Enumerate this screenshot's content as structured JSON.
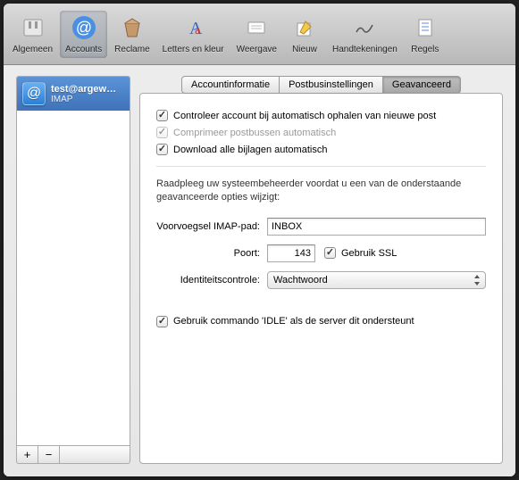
{
  "toolbar": {
    "items": [
      {
        "label": "Algemeen",
        "icon": "switch-icon"
      },
      {
        "label": "Accounts",
        "icon": "at-icon",
        "selected": true
      },
      {
        "label": "Reclame",
        "icon": "junk-icon"
      },
      {
        "label": "Letters en kleur",
        "icon": "fonts-icon"
      },
      {
        "label": "Weergave",
        "icon": "viewing-icon"
      },
      {
        "label": "Nieuw",
        "icon": "compose-icon"
      },
      {
        "label": "Handtekeningen",
        "icon": "signature-icon"
      },
      {
        "label": "Regels",
        "icon": "rules-icon"
      }
    ]
  },
  "sidebar": {
    "account": {
      "name": "test@argew…",
      "type": "IMAP"
    },
    "add": "+",
    "remove": "−"
  },
  "tabs": [
    {
      "label": "Accountinformatie"
    },
    {
      "label": "Postbusinstellingen"
    },
    {
      "label": "Geavanceerd",
      "active": true
    }
  ],
  "checkboxes": {
    "auto_fetch": {
      "label": "Controleer account bij automatisch ophalen van nieuwe post",
      "checked": true
    },
    "compress": {
      "label": "Comprimeer postbussen automatisch",
      "checked": true,
      "disabled": true
    },
    "download_all": {
      "label": "Download alle bijlagen automatisch",
      "checked": true
    },
    "use_ssl": {
      "label": "Gebruik SSL",
      "checked": true
    },
    "idle": {
      "label": "Gebruik commando 'IDLE' als de server dit ondersteunt",
      "checked": true
    }
  },
  "note": "Raadpleeg uw systeembeheerder voordat u een van de onderstaande geavanceerde opties wijzigt:",
  "form": {
    "prefix_label": "Voorvoegsel IMAP-pad:",
    "prefix_value": "INBOX",
    "port_label": "Poort:",
    "port_value": "143",
    "auth_label": "Identiteitscontrole:",
    "auth_value": "Wachtwoord"
  }
}
